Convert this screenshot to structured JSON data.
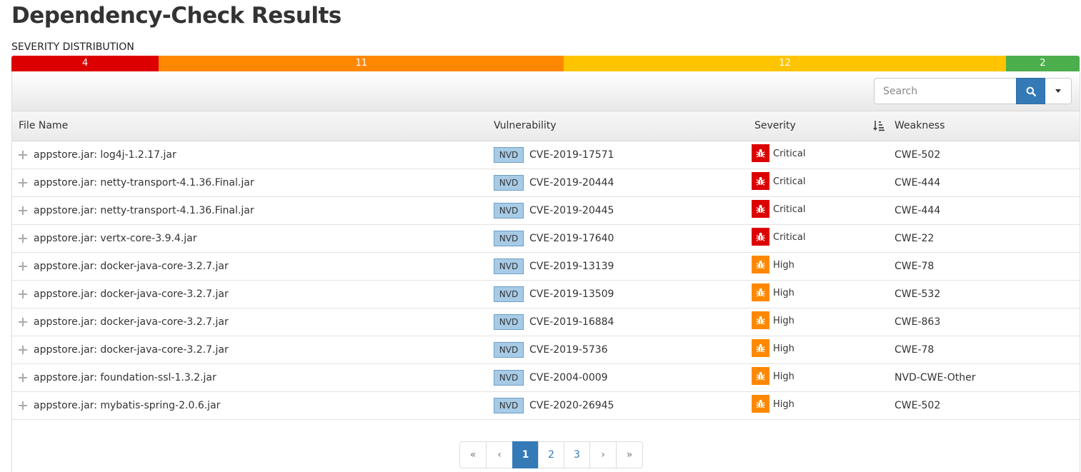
{
  "page": {
    "title": "Dependency-Check Results"
  },
  "severity_distribution": {
    "label": "SEVERITY DISTRIBUTION",
    "segments": [
      {
        "value": "4",
        "color": "#dd0000"
      },
      {
        "value": "11",
        "color": "#ff8800"
      },
      {
        "value": "12",
        "color": "#ffc400"
      },
      {
        "value": "2",
        "color": "#4cae4c"
      }
    ]
  },
  "search": {
    "placeholder": "Search",
    "button_icon": "search-icon",
    "dropdown_icon": "caret-down-icon"
  },
  "table": {
    "headers": {
      "file_name": "File Name",
      "vulnerability": "Vulnerability",
      "severity": "Severity",
      "weakness": "Weakness",
      "sort_icon": "sort-descending-icon"
    },
    "rows": [
      {
        "file": "appstore.jar: log4j-1.2.17.jar",
        "source": "NVD",
        "cve": "CVE-2019-17571",
        "severity": "Critical",
        "weakness": "CWE-502"
      },
      {
        "file": "appstore.jar: netty-transport-4.1.36.Final.jar",
        "source": "NVD",
        "cve": "CVE-2019-20444",
        "severity": "Critical",
        "weakness": "CWE-444"
      },
      {
        "file": "appstore.jar: netty-transport-4.1.36.Final.jar",
        "source": "NVD",
        "cve": "CVE-2019-20445",
        "severity": "Critical",
        "weakness": "CWE-444"
      },
      {
        "file": "appstore.jar: vertx-core-3.9.4.jar",
        "source": "NVD",
        "cve": "CVE-2019-17640",
        "severity": "Critical",
        "weakness": "CWE-22"
      },
      {
        "file": "appstore.jar: docker-java-core-3.2.7.jar",
        "source": "NVD",
        "cve": "CVE-2019-13139",
        "severity": "High",
        "weakness": "CWE-78"
      },
      {
        "file": "appstore.jar: docker-java-core-3.2.7.jar",
        "source": "NVD",
        "cve": "CVE-2019-13509",
        "severity": "High",
        "weakness": "CWE-532"
      },
      {
        "file": "appstore.jar: docker-java-core-3.2.7.jar",
        "source": "NVD",
        "cve": "CVE-2019-16884",
        "severity": "High",
        "weakness": "CWE-863"
      },
      {
        "file": "appstore.jar: docker-java-core-3.2.7.jar",
        "source": "NVD",
        "cve": "CVE-2019-5736",
        "severity": "High",
        "weakness": "CWE-78"
      },
      {
        "file": "appstore.jar: foundation-ssl-1.3.2.jar",
        "source": "NVD",
        "cve": "CVE-2004-0009",
        "severity": "High",
        "weakness": "NVD-CWE-Other"
      },
      {
        "file": "appstore.jar: mybatis-spring-2.0.6.jar",
        "source": "NVD",
        "cve": "CVE-2020-26945",
        "severity": "High",
        "weakness": "CWE-502"
      }
    ]
  },
  "severity_colors": {
    "Critical": "#dd0000",
    "High": "#ff8800"
  },
  "pagination": {
    "items": [
      {
        "label": "«",
        "type": "first"
      },
      {
        "label": "‹",
        "type": "prev"
      },
      {
        "label": "1",
        "type": "page",
        "active": true
      },
      {
        "label": "2",
        "type": "page"
      },
      {
        "label": "3",
        "type": "page"
      },
      {
        "label": "›",
        "type": "next"
      },
      {
        "label": "»",
        "type": "last"
      }
    ]
  }
}
